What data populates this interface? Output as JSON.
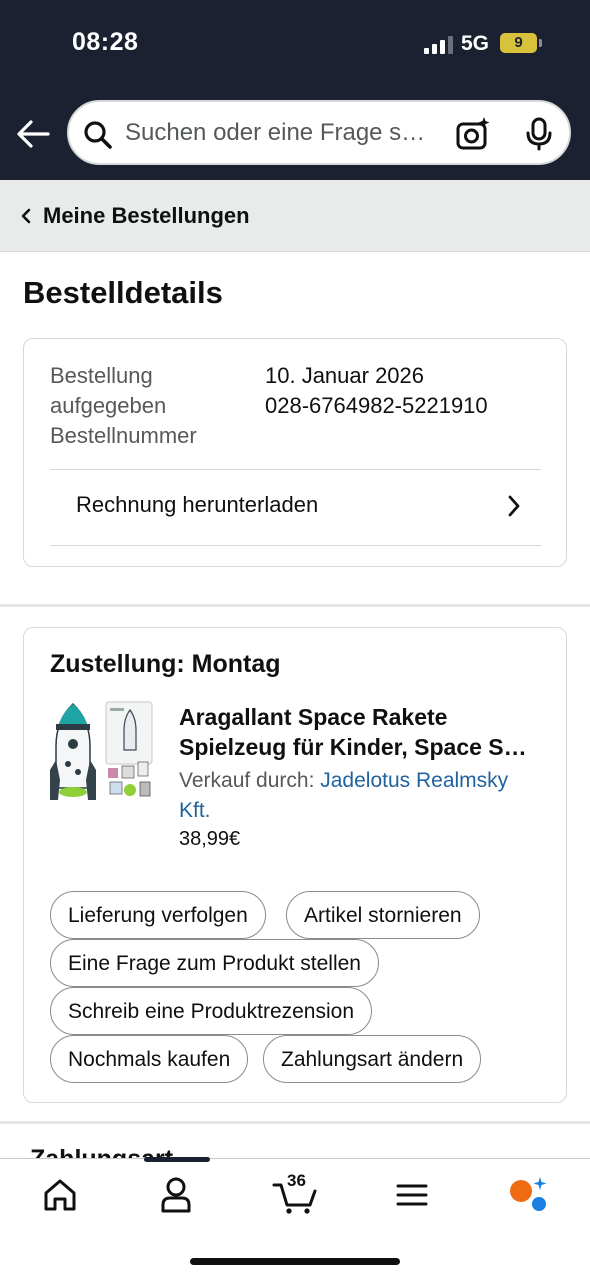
{
  "status_bar": {
    "time": "08:28",
    "network": "5G",
    "battery": "9"
  },
  "search": {
    "placeholder": "Suchen oder eine Frage s…"
  },
  "breadcrumb": {
    "label": "Meine Bestellungen"
  },
  "page": {
    "title": "Bestelldetails"
  },
  "order_info": {
    "label_line1": "Bestellung",
    "label_line2": "aufgegeben",
    "label_line3": "Bestellnummer",
    "date": "10. Januar 2026",
    "order_number": "028-6764982-5221910",
    "invoice_label": "Rechnung herunterladen"
  },
  "delivery": {
    "title": "Zustellung: Montag",
    "product": {
      "title_line1": "Aragallant Space Rakete",
      "title_line2": "Spielzeug für Kinder, Space S…",
      "seller_prefix": "Verkauf durch: ",
      "seller_name_part1": "Jadelotus Realmsky",
      "seller_name_part2": "Kft.",
      "price": "38,99€"
    },
    "actions": {
      "track": "Lieferung verfolgen",
      "cancel": "Artikel stornieren",
      "ask_question": "Eine Frage zum Produkt stellen",
      "write_review": "Schreib eine Produktrezension",
      "buy_again": "Nochmals kaufen",
      "change_payment": "Zahlungsart ändern"
    }
  },
  "next_section": {
    "title": "Zahlungsart"
  },
  "tabbar": {
    "cart_count": "36",
    "tabs": [
      "home-icon",
      "account-icon",
      "cart-icon",
      "menu-icon",
      "rufus-ai-icon"
    ]
  },
  "colors": {
    "header_bg": "#1b2130",
    "link": "#2162a1",
    "breadcrumb_bg": "#e9ebeb"
  }
}
